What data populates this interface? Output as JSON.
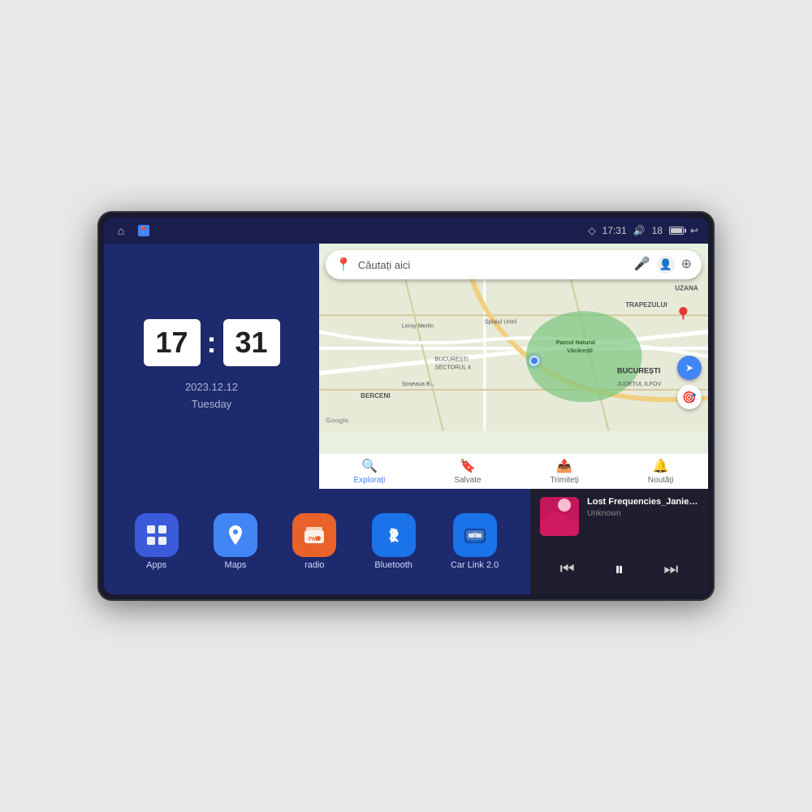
{
  "device": {
    "statusBar": {
      "time": "17:31",
      "signal": "18",
      "nav_icon_home": "⌂",
      "nav_icon_maps": "📍",
      "icons": {
        "location": "◇",
        "volume": "🔊",
        "battery_level": "—",
        "back": "↩"
      }
    },
    "clock": {
      "hour": "17",
      "minute": "31",
      "date": "2023.12.12",
      "day": "Tuesday"
    },
    "map": {
      "search_placeholder": "Căutați aici",
      "nav_items": [
        {
          "label": "Explorați",
          "active": true
        },
        {
          "label": "Salvate",
          "active": false
        },
        {
          "label": "Trimiteți",
          "active": false
        },
        {
          "label": "Noutăți",
          "active": false
        }
      ],
      "labels": {
        "bucuresti": "BUCUREȘTI",
        "judet_ilfov": "JUDEȚUL ILFOV",
        "trapezului": "TRAPEZULUI",
        "berceni": "BERCENI",
        "parcul": "Parcul Natural Văcărești",
        "leroy": "Leroy Merlin",
        "sector4": "BUCUREȘTI SECTORUL 4",
        "uzana": "UZANA",
        "splaiul": "Splaiul Unirii",
        "sosea_berceni": "Șoseaua B..."
      }
    },
    "apps": [
      {
        "id": "apps",
        "label": "Apps",
        "icon": "apps",
        "color": "#3b5bdb"
      },
      {
        "id": "maps",
        "label": "Maps",
        "icon": "maps",
        "color": "#4285f4"
      },
      {
        "id": "radio",
        "label": "radio",
        "icon": "radio",
        "color": "#e8622a"
      },
      {
        "id": "bluetooth",
        "label": "Bluetooth",
        "icon": "bluetooth",
        "color": "#1a73e8"
      },
      {
        "id": "carlink",
        "label": "Car Link 2.0",
        "icon": "carlink",
        "color": "#1a73e8"
      }
    ],
    "music": {
      "title": "Lost Frequencies_Janieck Devy-...",
      "artist": "Unknown",
      "controls": {
        "prev": "⏮",
        "play": "⏸",
        "next": "⏭"
      }
    }
  }
}
